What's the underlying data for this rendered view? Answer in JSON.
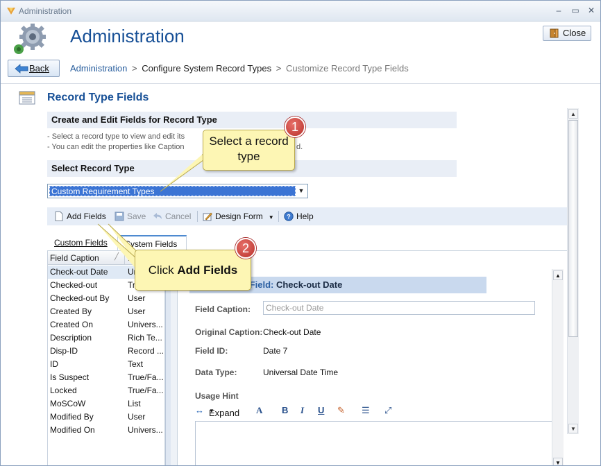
{
  "window": {
    "title": "Administration",
    "min_icon": "minimize-icon",
    "max_icon": "maximize-icon",
    "close_icon": "close-icon"
  },
  "header": {
    "title": "Administration",
    "back_label": "Back",
    "close_label": "Close",
    "breadcrumb": [
      "Administration",
      "Configure System Record Types",
      "Customize Record Type Fields"
    ],
    "breadcrumb_sep": ">"
  },
  "section": {
    "title": "Record Type Fields",
    "create_edit_heading": "Create and Edit Fields for Record Type",
    "desc1": "-  Select a record type to view and edit its",
    "desc1_tail": "d.",
    "desc2": "-  You can edit the properties like Caption",
    "select_heading": "Select Record Type",
    "selected_record_type": "Custom Requirement Types"
  },
  "toolbar": {
    "add_fields": "Add Fields",
    "save": "Save",
    "cancel": "Cancel",
    "design_form": "Design Form",
    "help": "Help"
  },
  "tabs": {
    "custom": "Custom Fields",
    "system": "System Fields"
  },
  "grid": {
    "col_caption": "Field Caption",
    "col_type": "D",
    "rows": [
      {
        "name": "Check-out Date",
        "type": "Ur"
      },
      {
        "name": "Checked-out",
        "type": "Tr"
      },
      {
        "name": "Checked-out By",
        "type": "User"
      },
      {
        "name": "Created By",
        "type": "User"
      },
      {
        "name": "Created On",
        "type": "Univers..."
      },
      {
        "name": "Description",
        "type": "Rich Te..."
      },
      {
        "name": "Disp-ID",
        "type": "Record ..."
      },
      {
        "name": "ID",
        "type": "Text"
      },
      {
        "name": "Is Suspect",
        "type": "True/Fa..."
      },
      {
        "name": "Locked",
        "type": "True/Fa..."
      },
      {
        "name": "MoSCoW",
        "type": "List"
      },
      {
        "name": "Modified By",
        "type": "User"
      },
      {
        "name": "Modified On",
        "type": "Univers..."
      }
    ]
  },
  "detail": {
    "heading_label": "r Field:",
    "heading_value": "Check-out Date",
    "field_caption_label": "Field Caption:",
    "field_caption_value": "Check-out Date",
    "original_caption_label": "Original Caption:",
    "original_caption_value": "Check-out Date",
    "field_id_label": "Field ID:",
    "field_id_value": "Date 7",
    "data_type_label": "Data Type:",
    "data_type_value": "Universal Date Time",
    "usage_hint_label": "Usage Hint",
    "expand_label": "Expand"
  },
  "callouts": {
    "one_text": "Select a record type",
    "one_badge": "1",
    "two_prefix": "Click ",
    "two_bold": "Add Fields",
    "two_badge": "2"
  },
  "colors": {
    "title_blue": "#164f96",
    "band": "#e9eef6",
    "selection": "#3b74d4",
    "callout": "#fdf6b4",
    "badge_red": "#b7312b"
  }
}
